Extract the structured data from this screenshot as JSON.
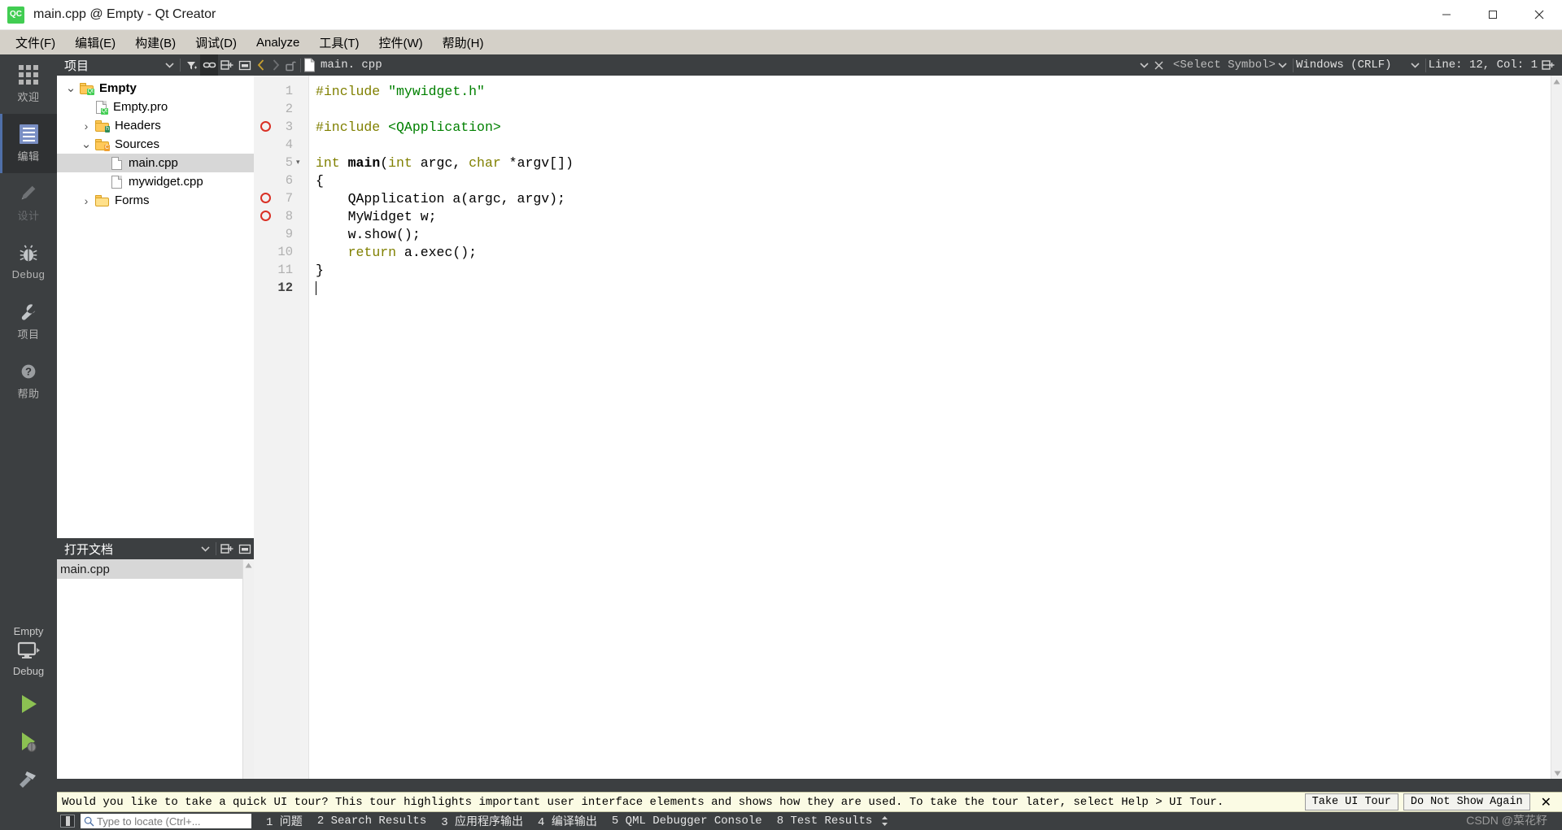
{
  "window": {
    "title": "main.cpp @ Empty - Qt Creator",
    "logo_text": "QC",
    "minimize": "─",
    "maximize": "☐",
    "close": "✕"
  },
  "menubar": {
    "items": [
      {
        "label": "文件(F)",
        "name": "menu-file"
      },
      {
        "label": "编辑(E)",
        "name": "menu-edit"
      },
      {
        "label": "构建(B)",
        "name": "menu-build"
      },
      {
        "label": "调试(D)",
        "name": "menu-debug"
      },
      {
        "label": "Analyze",
        "name": "menu-analyze"
      },
      {
        "label": "工具(T)",
        "name": "menu-tools"
      },
      {
        "label": "控件(W)",
        "name": "menu-window"
      },
      {
        "label": "帮助(H)",
        "name": "menu-help"
      }
    ]
  },
  "activitybar": {
    "items": [
      {
        "label": "欢迎",
        "icon": "grid-icon",
        "active": false,
        "dim": false
      },
      {
        "label": "编辑",
        "icon": "edit-icon",
        "active": true,
        "dim": false
      },
      {
        "label": "设计",
        "icon": "pencil-icon",
        "active": false,
        "dim": true
      },
      {
        "label": "Debug",
        "icon": "bug-icon",
        "active": false,
        "dim": false
      },
      {
        "label": "项目",
        "icon": "wrench-icon",
        "active": false,
        "dim": false
      },
      {
        "label": "帮助",
        "icon": "question-icon",
        "active": false,
        "dim": false
      }
    ]
  },
  "run_panel": {
    "kit_name": "Empty",
    "build_config": "Debug",
    "run_button": "run-icon",
    "debug_button": "debug-icon",
    "build_button": "hammer-icon"
  },
  "project_dock": {
    "title": "项目",
    "tools": [
      {
        "name": "dock-filter-dropdown-icon",
        "glyph": "▾"
      },
      {
        "name": "filter-icon",
        "glyph": "ᐁ"
      },
      {
        "name": "link-with-editor-icon",
        "glyph": "⚭"
      },
      {
        "name": "split-icon",
        "glyph": "⌸"
      },
      {
        "name": "close-dock-icon",
        "glyph": "⬜"
      }
    ],
    "tree": [
      {
        "label": "Empty",
        "depth": 0,
        "twisty": "open",
        "icon": "folder-qt",
        "bold": true,
        "selected": false
      },
      {
        "label": "Empty.pro",
        "depth": 1,
        "twisty": "none",
        "icon": "file-qt",
        "bold": false,
        "selected": false
      },
      {
        "label": "Headers",
        "depth": 1,
        "twisty": "closed",
        "icon": "folder-h",
        "bold": false,
        "selected": false
      },
      {
        "label": "Sources",
        "depth": 1,
        "twisty": "open",
        "icon": "folder-cpp",
        "bold": false,
        "selected": false
      },
      {
        "label": "main.cpp",
        "depth": 2,
        "twisty": "none",
        "icon": "file",
        "bold": false,
        "selected": true
      },
      {
        "label": "mywidget.cpp",
        "depth": 2,
        "twisty": "none",
        "icon": "file",
        "bold": false,
        "selected": false
      },
      {
        "label": "Forms",
        "depth": 1,
        "twisty": "closed",
        "icon": "folder-form",
        "bold": false,
        "selected": false
      }
    ]
  },
  "open_documents_dock": {
    "title": "打开文档",
    "tools": [
      {
        "name": "dock-dropdown-icon",
        "glyph": "▾"
      },
      {
        "name": "split-icon",
        "glyph": "⌸"
      },
      {
        "name": "close-dock-icon",
        "glyph": "⬜"
      }
    ],
    "documents": [
      {
        "label": "main.cpp",
        "selected": true
      }
    ]
  },
  "editor_toolbar": {
    "back": "‹",
    "forward": "›",
    "lock_icon": "unlocked-padlock-icon",
    "file_icon": "file-icon",
    "filename": "main. cpp",
    "filename_dropdown": "▾",
    "close_file": "✕",
    "symbol_placeholder": "<Select Symbol>",
    "symbol_dropdown": "▾",
    "line_ending": "Windows (CRLF)",
    "line_ending_dropdown": "▾",
    "cursor_position": "Line: 12, Col: 1",
    "split_icon": "split-editor-icon"
  },
  "editor": {
    "lines": [
      {
        "num": "1",
        "breakpoint": false,
        "fold": false,
        "tokens": [
          {
            "t": "#include ",
            "c": "k-pre"
          },
          {
            "t": "\"mywidget.h\"",
            "c": "k-str"
          }
        ]
      },
      {
        "num": "2",
        "breakpoint": false,
        "fold": false,
        "tokens": []
      },
      {
        "num": "3",
        "breakpoint": true,
        "fold": false,
        "tokens": [
          {
            "t": "#include ",
            "c": "k-pre"
          },
          {
            "t": "<QApplication>",
            "c": "k-str"
          }
        ]
      },
      {
        "num": "4",
        "breakpoint": false,
        "fold": false,
        "tokens": []
      },
      {
        "num": "5",
        "breakpoint": false,
        "fold": true,
        "tokens": [
          {
            "t": "int ",
            "c": "k-key"
          },
          {
            "t": "main",
            "c": "k-fn"
          },
          {
            "t": "(",
            "c": "k-plain"
          },
          {
            "t": "int",
            "c": "k-key"
          },
          {
            "t": " argc, ",
            "c": "k-plain"
          },
          {
            "t": "char",
            "c": "k-key"
          },
          {
            "t": " *argv[])",
            "c": "k-plain"
          }
        ]
      },
      {
        "num": "6",
        "breakpoint": false,
        "fold": false,
        "tokens": [
          {
            "t": "{",
            "c": "k-plain"
          }
        ]
      },
      {
        "num": "7",
        "breakpoint": true,
        "fold": false,
        "tokens": [
          {
            "t": "    QApplication a(argc, argv);",
            "c": "k-plain"
          }
        ]
      },
      {
        "num": "8",
        "breakpoint": true,
        "fold": false,
        "tokens": [
          {
            "t": "    MyWidget w;",
            "c": "k-plain"
          }
        ]
      },
      {
        "num": "9",
        "breakpoint": false,
        "fold": false,
        "tokens": [
          {
            "t": "    w.show();",
            "c": "k-plain"
          }
        ]
      },
      {
        "num": "10",
        "breakpoint": false,
        "fold": false,
        "tokens": [
          {
            "t": "    ",
            "c": "k-plain"
          },
          {
            "t": "return",
            "c": "k-key"
          },
          {
            "t": " a.exec();",
            "c": "k-plain"
          }
        ]
      },
      {
        "num": "11",
        "breakpoint": false,
        "fold": false,
        "tokens": [
          {
            "t": "}",
            "c": "k-plain"
          }
        ]
      },
      {
        "num": "12",
        "breakpoint": false,
        "fold": false,
        "current": true,
        "caret": true,
        "tokens": []
      }
    ]
  },
  "tour_banner": {
    "message": "Would you like to take a quick UI tour? This tour highlights important user interface elements and shows how they are used. To take the tour later, select Help > UI Tour.",
    "take_tour": "Take UI Tour",
    "do_not_show": "Do Not Show Again",
    "close": "✕"
  },
  "statusbar": {
    "toggle_sidebar": "toggle-sidebar-icon",
    "locator_placeholder": "Type to locate (Ctrl+...",
    "items": [
      {
        "label": "1 问题",
        "name": "status-issues"
      },
      {
        "label": "2 Search Results",
        "name": "status-search-results"
      },
      {
        "label": "3 应用程序输出",
        "name": "status-application-output"
      },
      {
        "label": "4 编译输出",
        "name": "status-compile-output"
      },
      {
        "label": "5 QML Debugger Console",
        "name": "status-qml-debugger-console"
      },
      {
        "label": "8 Test Results",
        "name": "status-test-results"
      }
    ],
    "watermark": "CSDN @菜花籽"
  },
  "colors": {
    "dark_chrome": "#3c3f41",
    "menubar": "#d4d0c8",
    "accent_blue": "#4f6fa8",
    "qt_green": "#41cd52",
    "breakpoint_red": "#d93025",
    "banner_yellow": "#fbfbe4",
    "selection_gray": "#d7d7d7"
  }
}
